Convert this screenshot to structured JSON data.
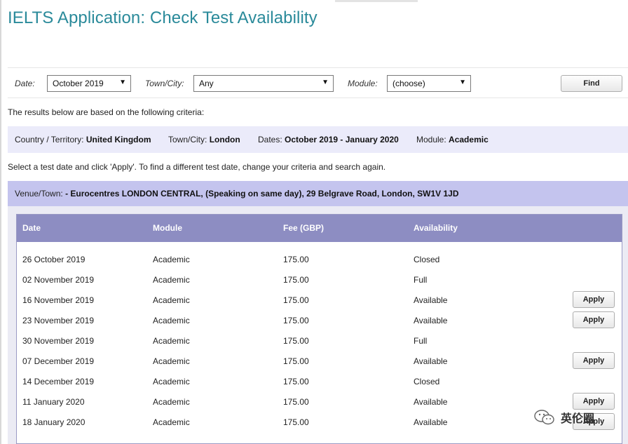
{
  "page": {
    "title": "IELTS Application: Check Test Availability"
  },
  "search": {
    "date_label": "Date:",
    "date_value": "October 2019",
    "town_label": "Town/City:",
    "town_value": "Any",
    "module_label": "Module:",
    "module_value": "(choose)",
    "find_button": "Find"
  },
  "criteria_intro": "The results below are based on the following criteria:",
  "criteria": {
    "country_label": "Country / Territory:",
    "country_value": "United Kingdom",
    "town_label": "Town/City:",
    "town_value": "London",
    "dates_label": "Dates:",
    "dates_value": "October 2019 - January 2020",
    "module_label": "Module:",
    "module_value": "Academic"
  },
  "instructions": "Select a test date and click 'Apply'. To find a different test date, change your criteria and search again.",
  "venue": {
    "label": "Venue/Town:",
    "value": "- Eurocentres LONDON CENTRAL, (Speaking on same day), 29 Belgrave Road, London, SW1V 1JD"
  },
  "table": {
    "headers": [
      "Date",
      "Module",
      "Fee (GBP)",
      "Availability"
    ],
    "apply_label": "Apply",
    "rows": [
      {
        "date": "26 October 2019",
        "module": "Academic",
        "fee": "175.00",
        "availability": "Closed"
      },
      {
        "date": "02 November 2019",
        "module": "Academic",
        "fee": "175.00",
        "availability": "Full"
      },
      {
        "date": "16 November 2019",
        "module": "Academic",
        "fee": "175.00",
        "availability": "Available"
      },
      {
        "date": "23 November 2019",
        "module": "Academic",
        "fee": "175.00",
        "availability": "Available"
      },
      {
        "date": "30 November 2019",
        "module": "Academic",
        "fee": "175.00",
        "availability": "Full"
      },
      {
        "date": "07 December 2019",
        "module": "Academic",
        "fee": "175.00",
        "availability": "Available"
      },
      {
        "date": "14 December 2019",
        "module": "Academic",
        "fee": "175.00",
        "availability": "Closed"
      },
      {
        "date": "11 January 2020",
        "module": "Academic",
        "fee": "175.00",
        "availability": "Available"
      },
      {
        "date": "18 January 2020",
        "module": "Academic",
        "fee": "175.00",
        "availability": "Available"
      }
    ]
  },
  "watermark": {
    "text": "英伦圈",
    "icon": "wechat-icon"
  },
  "colors": {
    "title": "#2a8a9a",
    "table_header": "#8d8dc2",
    "venue_bar": "#c4c4ee",
    "criteria_bar": "#ebebfa"
  }
}
